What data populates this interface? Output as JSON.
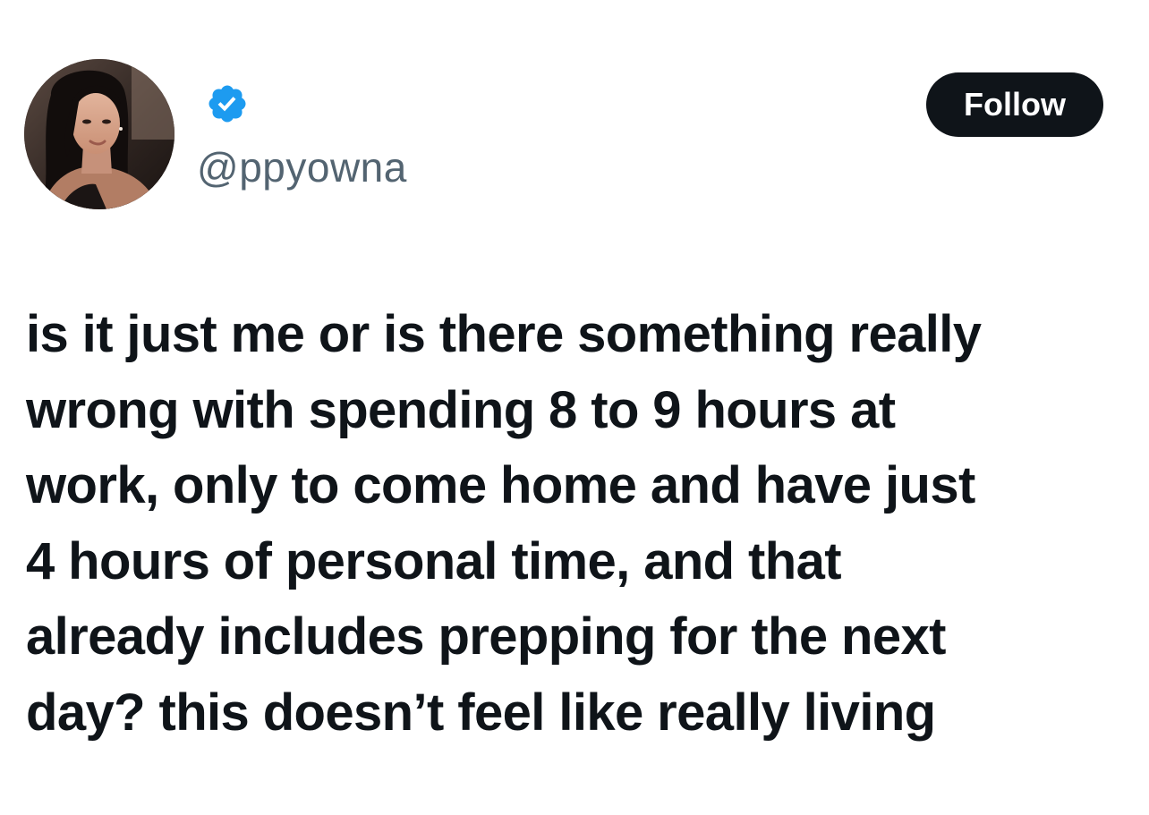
{
  "author": {
    "handle": "@ppyowna",
    "verified": true,
    "avatar_icon": "profile-photo"
  },
  "actions": {
    "follow_label": "Follow"
  },
  "tweet": {
    "lines": [
      "is it just me or is there something really",
      "wrong with spending 8 to 9 hours at",
      "work, only to come home and have just",
      "4 hours of personal time, and that",
      "already includes prepping for the next",
      "day? this doesn’t feel like really living"
    ]
  },
  "colors": {
    "text": "#0f1419",
    "handle": "#536471",
    "verified_badge": "#1d9bf0",
    "follow_button_bg": "#0f1419",
    "follow_button_text": "#ffffff",
    "background": "#ffffff"
  }
}
